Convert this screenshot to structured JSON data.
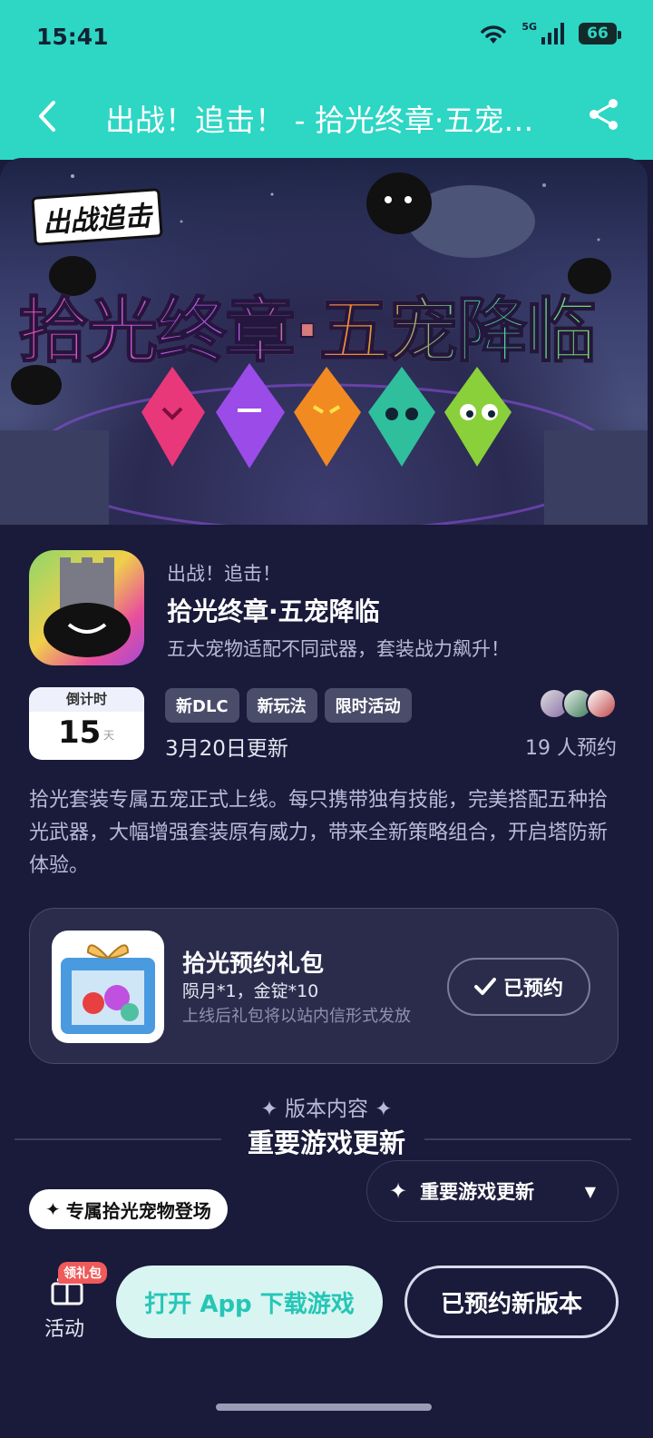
{
  "status": {
    "time": "15:41",
    "network": "5G",
    "battery": "66"
  },
  "header": {
    "title": "出战！追击！ - 拾光终章·五宠降临",
    "back_icon": "chevron-left-icon",
    "share_icon": "share-icon"
  },
  "banner": {
    "logo": "出战追击",
    "title": "拾光终章·五宠降临"
  },
  "game": {
    "name": "出战！追击！",
    "title": "拾光终章·五宠降临",
    "description": "五大宠物适配不同武器，套装战力飙升！"
  },
  "countdown": {
    "label": "倒计时",
    "value": "15",
    "unit": "天"
  },
  "tags": [
    "新DLC",
    "新玩法",
    "限时活动"
  ],
  "update_date": "3月20日更新",
  "reserve_count": "19 人预约",
  "intro": "拾光套装专属五宠正式上线。每只携带独有技能，完美搭配五种拾光武器，大幅增强套装原有威力，带来全新策略组合，开启塔防新体验。",
  "gift": {
    "title": "拾光预约礼包",
    "items": "陨月*1，金锭*10",
    "note": "上线后礼包将以站内信形式发放",
    "button_label": "已预约"
  },
  "version": {
    "section_label": "✦ 版本内容 ✦",
    "title": "重要游戏更新",
    "pet_tag": "专属拾光宠物登场",
    "dropdown_label": "重要游戏更新"
  },
  "bottom": {
    "activity_badge": "领礼包",
    "activity_label": "活动",
    "open_button": "打开 App 下载游戏",
    "reserved_button": "已预约新版本"
  },
  "colors": {
    "header_bg": "#2ed6c4",
    "page_bg": "#1a1a3a",
    "accent_text": "#26c6b6"
  }
}
